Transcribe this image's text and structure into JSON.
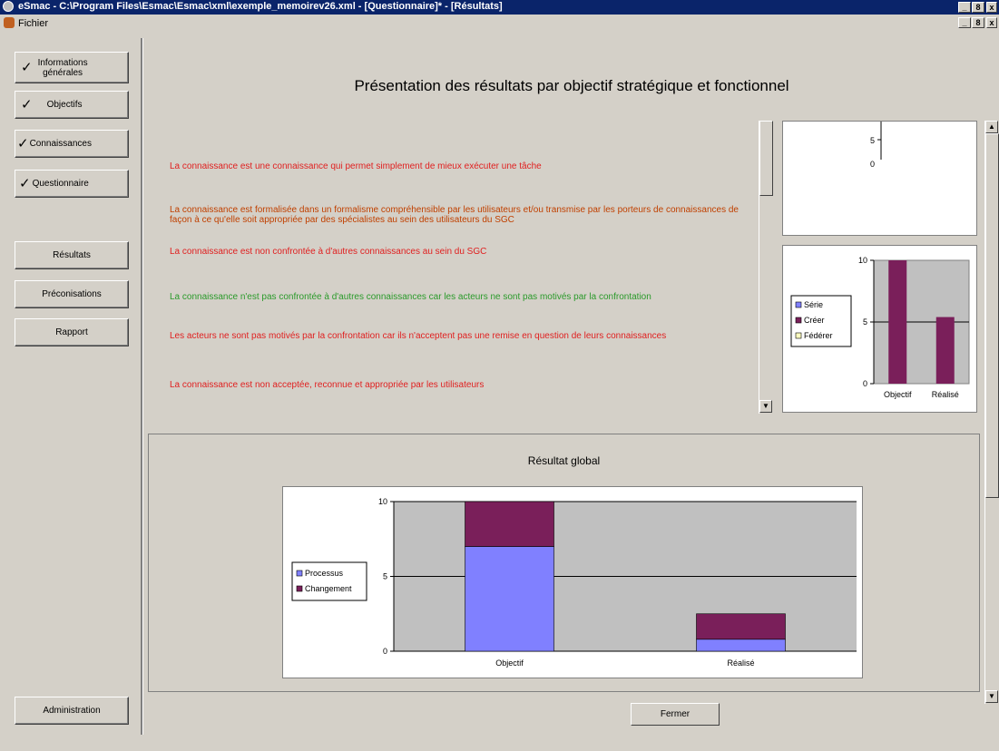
{
  "window": {
    "title": "eSmac - C:\\Program Files\\Esmac\\Esmac\\xml\\exemple_memoirev26.xml - [Questionnaire]* - [Résultats]",
    "minimize": "_",
    "restore": "8",
    "close": "x"
  },
  "menu": {
    "file": "Fichier"
  },
  "nav": {
    "informations_line1": "Informations",
    "informations_line2": "générales",
    "objectifs": "Objectifs",
    "connaissances": "Connaissances",
    "questionnaire": "Questionnaire",
    "resultats": "Résultats",
    "preconisations": "Préconisations",
    "rapport": "Rapport",
    "administration": "Administration",
    "check_glyph": "✓"
  },
  "main": {
    "heading": "Présentation des résultats par objectif stratégique et fonctionnel",
    "items": [
      {
        "text": "La connaissance est une connaissance qui permet simplement de mieux exécuter une tâche",
        "color": "#e02020"
      },
      {
        "text": "La connaissance est formalisée dans un formalisme compréhensible par les utilisateurs et/ou transmise par les porteurs de connaissances de façon à ce qu'elle soit appropriée par des spécialistes au sein des utilisateurs du SGC",
        "color": "#c04000"
      },
      {
        "text": "La connaissance est non confrontée à d'autres connaissances au sein du SGC",
        "color": "#e02020"
      },
      {
        "text": "La connaissance n'est pas confrontée à d'autres connaissances car les acteurs ne sont pas motivés par la confrontation",
        "color": "#2a9a2a"
      },
      {
        "text": "Les acteurs ne sont pas motivés par la confrontation car ils n'acceptent pas une remise en question de leurs connaissances",
        "color": "#e02020"
      },
      {
        "text": "La connaissance est non acceptée, reconnue et appropriée par les utilisateurs",
        "color": "#e02020"
      }
    ],
    "close_button": "Fermer"
  },
  "chart_data": [
    {
      "type": "bar",
      "title": "",
      "categories": [
        "Objectif",
        "Réalisé"
      ],
      "series": [
        {
          "name": "Série",
          "values": [
            0,
            0
          ]
        },
        {
          "name": "Créer",
          "values": [
            10,
            5.4
          ]
        },
        {
          "name": "Fédérer",
          "values": [
            0,
            0
          ]
        }
      ],
      "ylim": [
        0,
        10
      ],
      "yticks": [
        "0",
        "5",
        "10"
      ],
      "legend": "left",
      "colors": [
        "#8080ff",
        "#7a1f5a",
        "#ffffc0"
      ]
    },
    {
      "type": "bar",
      "stacked": true,
      "title": "Résultat global",
      "categories": [
        "Objectif",
        "Réalisé"
      ],
      "series": [
        {
          "name": "Processus",
          "values": [
            7,
            0.8
          ]
        },
        {
          "name": "Changement",
          "values": [
            3,
            1.7
          ]
        }
      ],
      "ylim": [
        0,
        10
      ],
      "yticks": [
        "0",
        "5",
        "10"
      ],
      "legend": "left",
      "colors": [
        "#8080ff",
        "#7a1f5a"
      ]
    }
  ],
  "partial_chart": {
    "ytick_5": "5",
    "ytick_0": "0"
  },
  "scroll": {
    "up": "▲",
    "down": "▼"
  }
}
